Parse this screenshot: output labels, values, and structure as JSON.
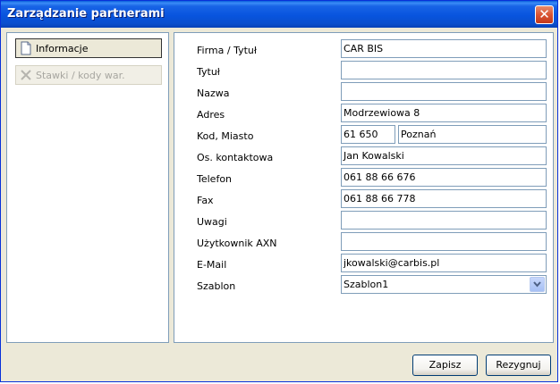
{
  "window": {
    "title": "Zarządzanie partnerami",
    "close_glyph": "✕"
  },
  "nav": [
    {
      "label": "Informacje",
      "icon": "document-icon",
      "active": true
    },
    {
      "label": "Stawki / kody war.",
      "icon": "cross-icon",
      "active": false
    }
  ],
  "form": {
    "firma_label": "Firma / Tytuł",
    "firma_value": "CAR BIS",
    "tytul_label": "Tytuł",
    "tytul_value": "",
    "nazwa_label": "Nazwa",
    "nazwa_value": "",
    "adres_label": "Adres",
    "adres_value": "Modrzewiowa 8",
    "kod_miasto_label": "Kod, Miasto",
    "kod_value": "61 650",
    "miasto_value": "Poznań",
    "kontakt_label": "Os. kontaktowa",
    "kontakt_value": "Jan Kowalski",
    "telefon_label": "Telefon",
    "telefon_value": "061 88 66 676",
    "fax_label": "Fax",
    "fax_value": "061 88 66 778",
    "uwagi_label": "Uwagi",
    "uwagi_value": "",
    "uzytkownik_label": "Użytkownik AXN",
    "uzytkownik_value": "",
    "email_label": "E-Mail",
    "email_value": "jkowalski@carbis.pl",
    "szablon_label": "Szablon",
    "szablon_value": "Szablon1"
  },
  "buttons": {
    "save": "Zapisz",
    "cancel": "Rezygnuj"
  }
}
